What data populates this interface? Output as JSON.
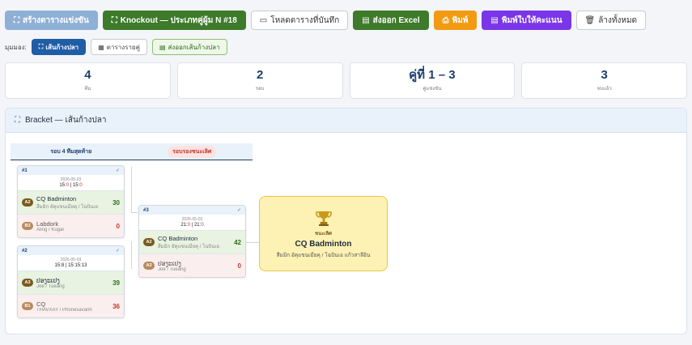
{
  "toolbar": {
    "create": "สร้างตารางแข่งขัน",
    "knockout": "Knockout — ประเภทคู่ผู้ม N #18",
    "download": "โหลดตารางที่บันทึก",
    "excel": "ส่งออก Excel",
    "print": "พิมพ์",
    "print_referee": "พิมพ์ใบให้คะแนน",
    "clear": "ล้างทั้งหมด"
  },
  "view": {
    "label": "มุมมอง:",
    "fishbone": "เส้นก้างปลา",
    "pairs": "ตารางรายคู่",
    "export_fishbone": "ส่งออกเส้นก้างปลา"
  },
  "stats": [
    {
      "value": "4",
      "label": "ทีม"
    },
    {
      "value": "2",
      "label": "รอบ"
    },
    {
      "value": "คู่ที่ 1 – 3",
      "label": "คู่แข่งขัน"
    },
    {
      "value": "3",
      "label": "จบแล้ว"
    }
  ],
  "bracket": {
    "title": "Bracket — เส้นก้างปลา",
    "rounds": [
      "รอบ 4 ทีมสุดท้าย",
      "รอบรองชนะเลิศ"
    ],
    "matches": [
      {
        "id": "#1",
        "date": "2026-05-03",
        "scores": [
          "15",
          "0",
          "15",
          "0"
        ],
        "players": [
          {
            "seed": "A2",
            "name": "CQ Badminton",
            "sub": "สีมมิก อัคุแขนเมียคุ / โฉบินเอ",
            "score": "30",
            "result": "win"
          },
          {
            "seed": "B3",
            "name": "Labdork",
            "sub": "Aling / Kugar",
            "score": "0",
            "result": "lose"
          }
        ]
      },
      {
        "id": "#2",
        "date": "2026-05-03",
        "scores": [
          "15",
          "8",
          "15",
          "15",
          "13"
        ],
        "players": [
          {
            "seed": "A3",
            "name": "ປອງະເປງ",
            "sub": "Joe / Tueang",
            "score": "39",
            "result": "win"
          },
          {
            "seed": "B1",
            "name": "CQ",
            "sub": "THAVXAY / Phonesavanh",
            "score": "36",
            "result": "lose"
          }
        ]
      },
      {
        "id": "#3",
        "date": "2026-05-03",
        "scores": [
          "21",
          "0",
          "21",
          "0"
        ],
        "players": [
          {
            "seed": "A2",
            "name": "CQ Badminton",
            "sub": "สีมมิก อัคุแขนเมียคุ / โฉบินเอ",
            "score": "42",
            "result": "win"
          },
          {
            "seed": "A3",
            "name": "ປອງະເປງ",
            "sub": "Joe / Tueang",
            "score": "0",
            "result": "lose"
          }
        ]
      }
    ],
    "champion": {
      "label": "ชนะเลิศ",
      "name": "CQ Badminton",
      "sub": "สีมมิก อัคุแขนเมียคุ / โฉบินเอ แก้วสาลีอิน"
    }
  }
}
